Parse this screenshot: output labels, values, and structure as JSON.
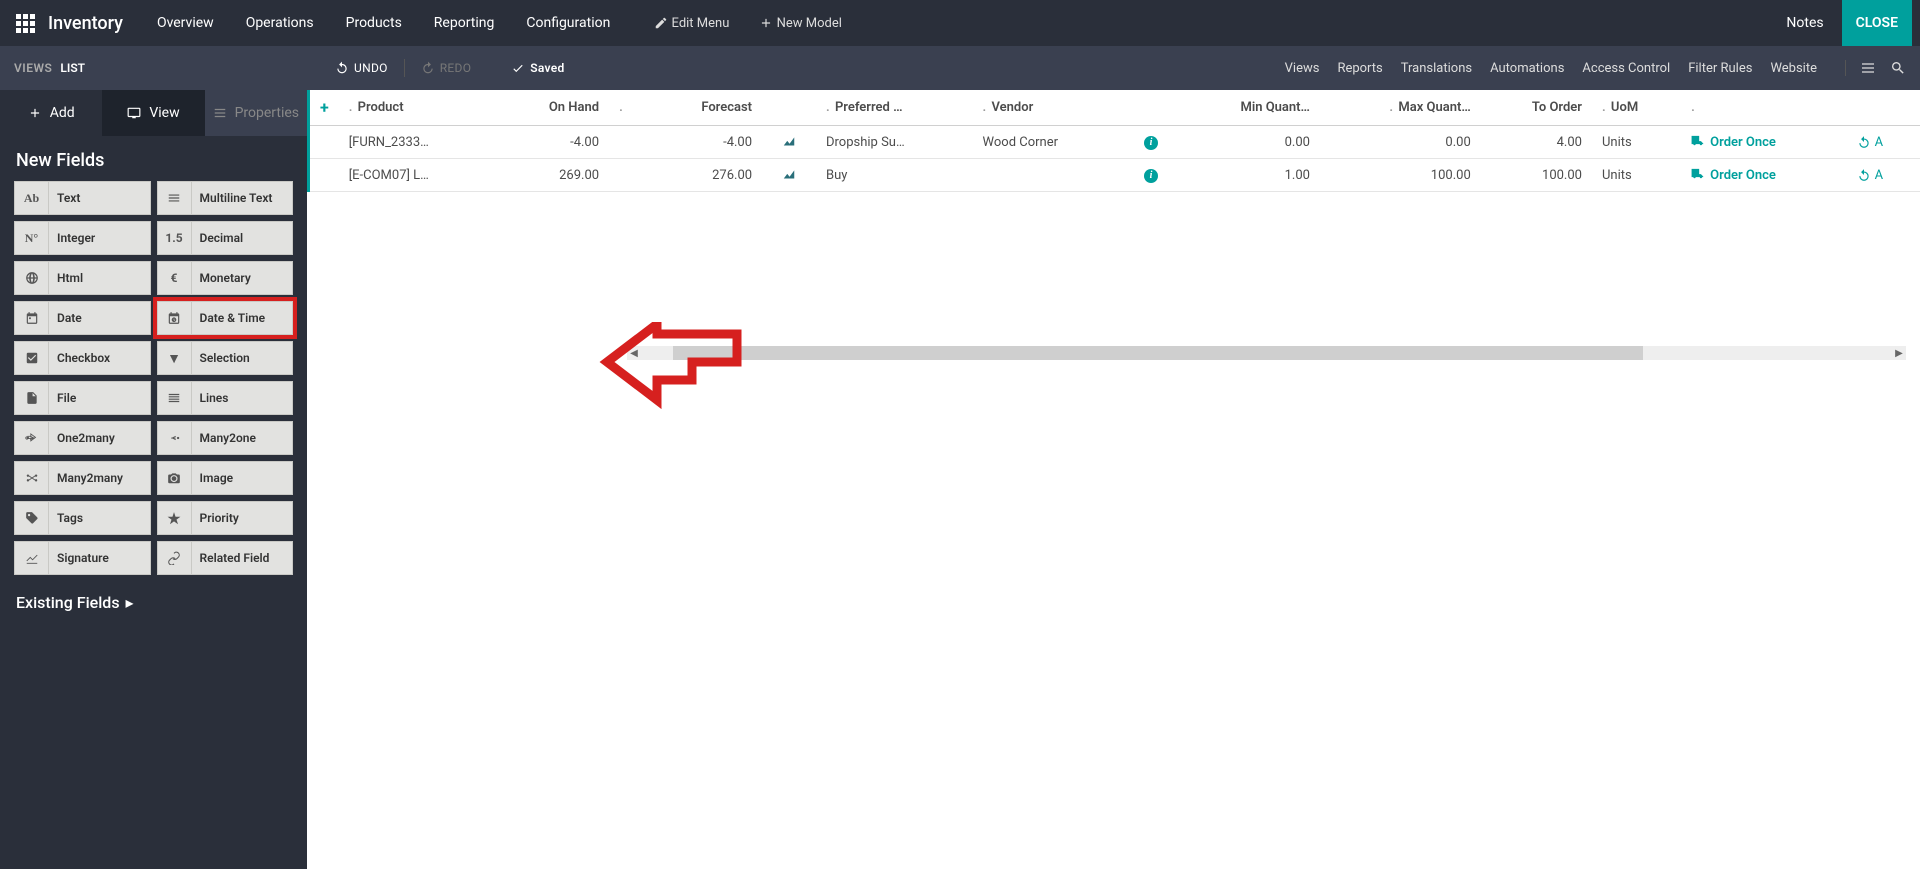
{
  "topnav": {
    "brand": "Inventory",
    "menu": [
      "Overview",
      "Operations",
      "Products",
      "Reporting",
      "Configuration"
    ],
    "edit_menu": "Edit Menu",
    "new_model": "New Model",
    "notes": "Notes",
    "close": "CLOSE"
  },
  "subbar": {
    "views": "VIEWS",
    "list": "LIST",
    "undo": "UNDO",
    "redo": "REDO",
    "saved": "Saved",
    "right_links": [
      "Views",
      "Reports",
      "Translations",
      "Automations",
      "Access Control",
      "Filter Rules",
      "Website"
    ]
  },
  "leftpanel": {
    "tab_add": "Add",
    "tab_view": "View",
    "tab_props": "Properties",
    "new_fields": "New Fields",
    "existing_fields": "Existing Fields",
    "fields": [
      {
        "icon": "Ab",
        "label": "Text"
      },
      {
        "icon": "≡",
        "label": "Multiline Text"
      },
      {
        "icon": "N°",
        "label": "Integer"
      },
      {
        "icon": "1.5",
        "label": "Decimal"
      },
      {
        "icon": "globe",
        "label": "Html"
      },
      {
        "icon": "€",
        "label": "Monetary"
      },
      {
        "icon": "cal",
        "label": "Date"
      },
      {
        "icon": "calclock",
        "label": "Date & Time",
        "highlight": true
      },
      {
        "icon": "check",
        "label": "Checkbox"
      },
      {
        "icon": "▾",
        "label": "Selection"
      },
      {
        "icon": "file",
        "label": "File"
      },
      {
        "icon": "lines",
        "label": "Lines"
      },
      {
        "icon": "o2m",
        "label": "One2many"
      },
      {
        "icon": "m2o",
        "label": "Many2one"
      },
      {
        "icon": "m2m",
        "label": "Many2many"
      },
      {
        "icon": "camera",
        "label": "Image"
      },
      {
        "icon": "tag",
        "label": "Tags"
      },
      {
        "icon": "star",
        "label": "Priority"
      },
      {
        "icon": "sig",
        "label": "Signature"
      },
      {
        "icon": "link",
        "label": "Related Field"
      }
    ]
  },
  "table": {
    "headers": [
      "Product",
      "On Hand",
      "",
      "Forecast",
      "",
      "Preferred …",
      "Vendor",
      "",
      "Min Quant…",
      "Max Quant…",
      "To Order",
      "UoM",
      ""
    ],
    "rows": [
      {
        "product": "[FURN_2333…",
        "onhand": "-4.00",
        "forecast": "-4.00",
        "route": "Dropship Su…",
        "vendor": "Wood Corner",
        "min": "0.00",
        "max": "0.00",
        "toorder": "4.00",
        "uom": "Units",
        "action": "Order Once"
      },
      {
        "product": "[E-COM07] L…",
        "onhand": "269.00",
        "forecast": "276.00",
        "route": "Buy",
        "vendor": "",
        "min": "1.00",
        "max": "100.00",
        "toorder": "100.00",
        "uom": "Units",
        "action": "Order Once"
      }
    ]
  }
}
